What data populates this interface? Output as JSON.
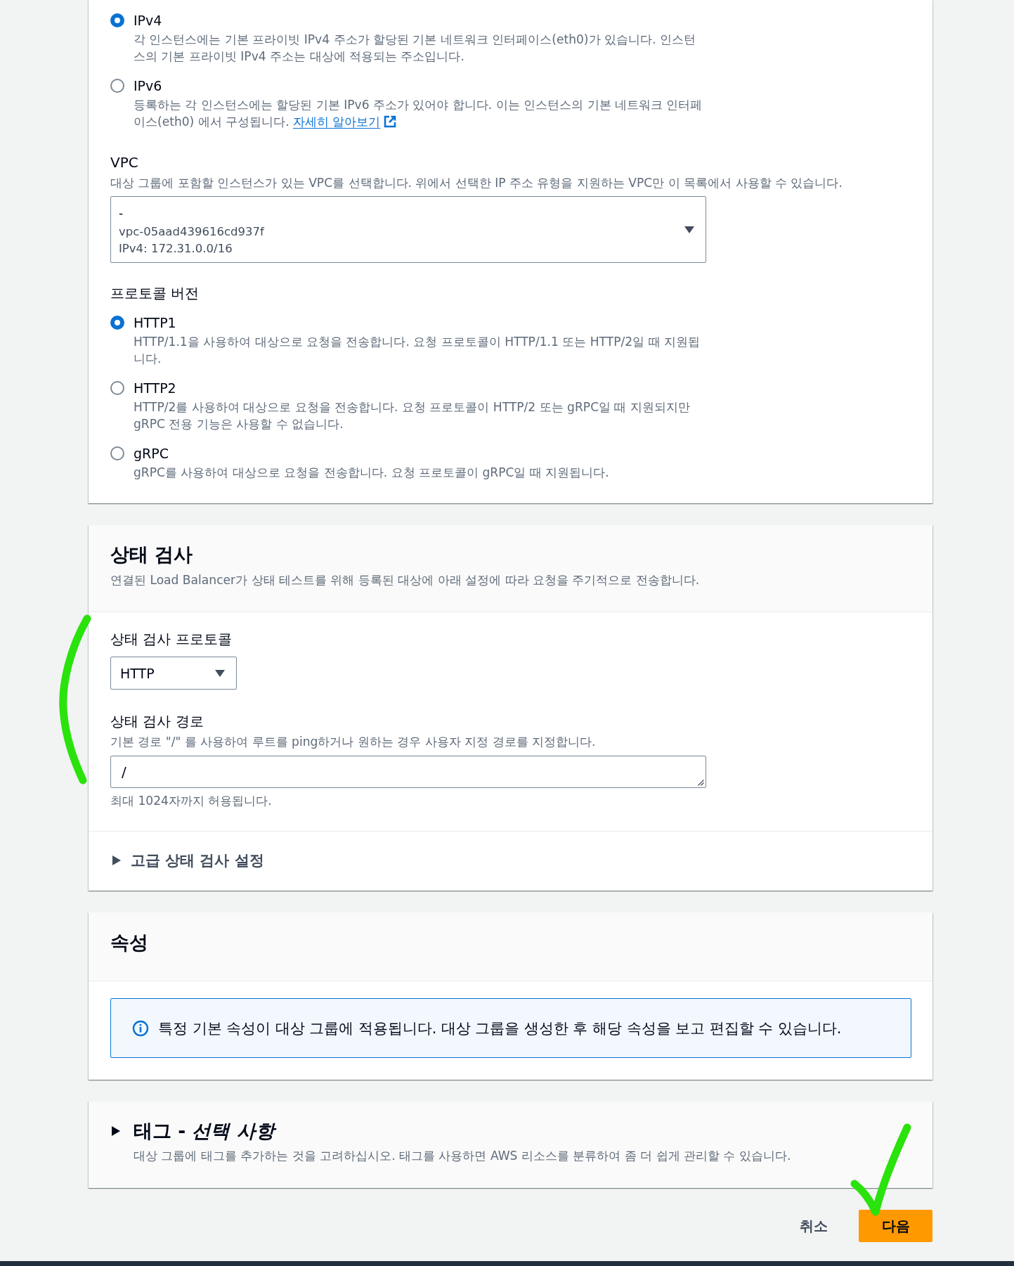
{
  "ip_address_type": {
    "options": [
      {
        "label": "IPv4",
        "description": "각 인스턴스에는 기본 프라이빗 IPv4 주소가 할당된 기본 네트워크 인터페이스(eth0)가 있습니다. 인스턴스의 기본 프라이빗 IPv4 주소는 대상에 적용되는 주소입니다.",
        "selected": true
      },
      {
        "label": "IPv6",
        "description": "등록하는 각 인스턴스에는 할당된 기본 IPv6 주소가 있어야 합니다. 이는 인스턴스의 기본 네트워크 인터페이스(eth0) 에서 구성됩니다.",
        "link": "자세히 알아보기",
        "selected": false
      }
    ]
  },
  "vpc": {
    "label": "VPC",
    "description": "대상 그룹에 포함할 인스턴스가 있는 VPC를 선택합니다. 위에서 선택한 IP 주소 유형을 지원하는 VPC만 이 목록에서 사용할 수 있습니다.",
    "select": {
      "name": "-",
      "id": "vpc-05aad439616cd937f",
      "cidr": "IPv4: 172.31.0.0/16"
    }
  },
  "protocol_version": {
    "label": "프로토콜 버전",
    "options": [
      {
        "label": "HTTP1",
        "description": "HTTP/1.1을 사용하여 대상으로 요청을 전송합니다. 요청 프로토콜이 HTTP/1.1 또는 HTTP/2일 때 지원됩니다.",
        "selected": true
      },
      {
        "label": "HTTP2",
        "description": "HTTP/2를 사용하여 대상으로 요청을 전송합니다. 요청 프로토콜이 HTTP/2 또는 gRPC일 때 지원되지만 gRPC 전용 기능은 사용할 수 없습니다.",
        "selected": false
      },
      {
        "label": "gRPC",
        "description": "gRPC를 사용하여 대상으로 요청을 전송합니다. 요청 프로토콜이 gRPC일 때 지원됩니다.",
        "selected": false
      }
    ]
  },
  "health_checks": {
    "title": "상태 검사",
    "description": "연결된 Load Balancer가 상태 테스트를 위해 등록된 대상에 아래 설정에 따라 요청을 주기적으로 전송합니다.",
    "protocol": {
      "label": "상태 검사 프로토콜",
      "value": "HTTP"
    },
    "path": {
      "label": "상태 검사 경로",
      "description": "기본 경로 \"/\" 를 사용하여 루트를 ping하거나 원하는 경우 사용자 지정 경로를 지정합니다.",
      "value": "/",
      "hint": "최대 1024자까지 허용됩니다."
    },
    "advanced": {
      "label": "고급 상태 검사 설정",
      "expanded": false
    }
  },
  "attributes": {
    "title": "속성",
    "info": "특정 기본 속성이 대상 그룹에 적용됩니다. 대상 그룹을 생성한 후 해당 속성을 보고 편집할 수 있습니다."
  },
  "tags": {
    "title": "태그 - *선택 사항*",
    "description": "대상 그룹에 태그를 추가하는 것을 고려하십시오. 태그를 사용하면 AWS 리소스를 분류하여 좀 더 쉽게 관리할 수 있습니다.",
    "expanded": false
  },
  "actions": [
    {
      "label": "취소",
      "kind": "link"
    },
    {
      "label": "다음",
      "kind": "primary"
    }
  ],
  "annotations": {
    "bracket": true,
    "checkmark": true
  }
}
